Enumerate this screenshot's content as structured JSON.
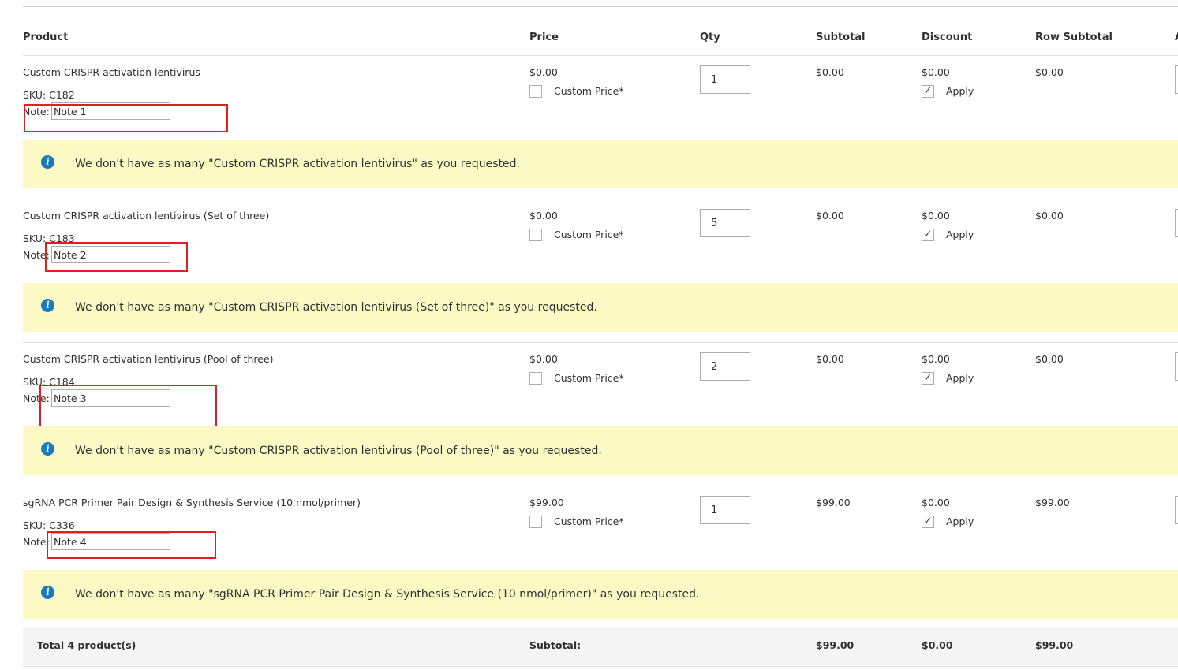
{
  "columns": {
    "product": "Product",
    "price": "Price",
    "qty": "Qty",
    "subtotal": "Subtotal",
    "discount": "Discount",
    "row_subtotal": "Row Subtotal",
    "action": "A"
  },
  "labels": {
    "sku_prefix": "SKU:",
    "note": "Note:",
    "custom_price": "Custom Price*",
    "apply": "Apply"
  },
  "items": [
    {
      "name": "Custom CRISPR activation lentivirus",
      "sku": "SKU: C182",
      "note_label": "Note:",
      "note": "Note 1",
      "price": "$0.00",
      "custom_price_checked": false,
      "qty": "1",
      "subtotal": "$0.00",
      "discount": "$0.00",
      "apply_checked": true,
      "row_subtotal": "$0.00",
      "message": "We don't have as many \"Custom CRISPR activation lentivirus\" as you requested."
    },
    {
      "name": "Custom CRISPR activation lentivirus (Set of three)",
      "sku": "SKU: C183",
      "note_label": "Note:",
      "note": "Note 2",
      "price": "$0.00",
      "custom_price_checked": false,
      "qty": "5",
      "subtotal": "$0.00",
      "discount": "$0.00",
      "apply_checked": true,
      "row_subtotal": "$0.00",
      "message": "We don't have as many \"Custom CRISPR activation lentivirus (Set of three)\" as you requested."
    },
    {
      "name": "Custom CRISPR activation lentivirus (Pool of three)",
      "sku": "SKU: C184",
      "note_label": "Note:",
      "note": "Note 3",
      "price": "$0.00",
      "custom_price_checked": false,
      "qty": "2",
      "subtotal": "$0.00",
      "discount": "$0.00",
      "apply_checked": true,
      "row_subtotal": "$0.00",
      "message": "We don't have as many \"Custom CRISPR activation lentivirus (Pool of three)\" as you requested."
    },
    {
      "name": "sgRNA PCR Primer Pair Design & Synthesis Service (10 nmol/primer)",
      "sku": "SKU: C336",
      "note_label": "Note:",
      "note": "Note 4",
      "price": "$99.00",
      "custom_price_checked": false,
      "qty": "1",
      "subtotal": "$99.00",
      "discount": "$0.00",
      "apply_checked": true,
      "row_subtotal": "$99.00",
      "message": "We don't have as many \"sgRNA PCR Primer Pair Design & Synthesis Service (10 nmol/primer)\" as you requested."
    }
  ],
  "footer": {
    "total_products": "Total 4 product(s)",
    "subtotal_label": "Subtotal:",
    "subtotal": "$99.00",
    "discount": "$0.00",
    "row_subtotal": "$99.00"
  },
  "icons": {
    "info": "info-icon",
    "check": "checkmark-icon"
  },
  "colors": {
    "notice_background": "#fdf9c4",
    "info_icon": "#1979c3",
    "highlight_annotation": "#e02020",
    "footer_background": "#f5f5f5"
  }
}
